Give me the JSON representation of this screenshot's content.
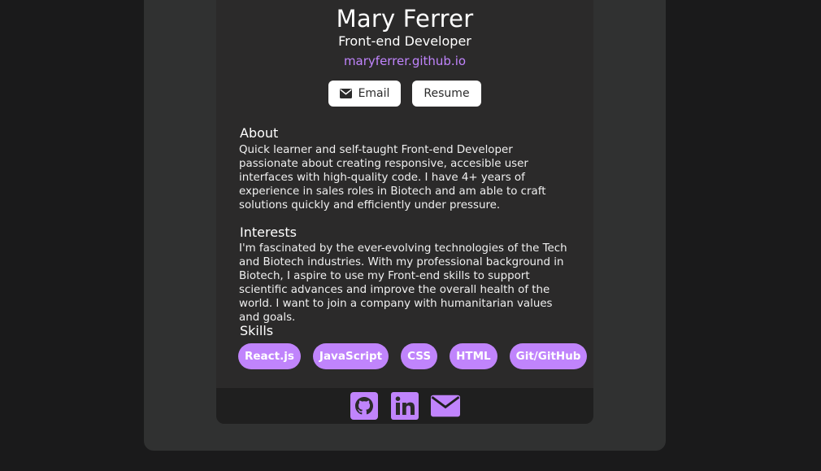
{
  "profile": {
    "name": "Mary Ferrer",
    "role": "Front-end Developer",
    "website": "maryferrer.github.io"
  },
  "buttons": {
    "email_label": "Email",
    "resume_label": "Resume"
  },
  "about": {
    "title": "About",
    "text": "Quick learner and self-taught Front-end Developer passionate about creating responsive, accesible user interfaces with high-quality code. I have 4+ years of experience in sales roles in Biotech and am able to craft solutions quickly and efficiently under pressure."
  },
  "interests": {
    "title": "Interests",
    "text": "I'm fascinated by the ever-evolving technologies of the Tech and Biotech industries. With my professional background in Biotech, I aspire to use my Front-end skills to support scientific advances and improve the overall health of the world. I want to join a company with humanitarian values and goals."
  },
  "skills": {
    "title": "Skills",
    "items": [
      "React.js",
      "JavaScript",
      "CSS",
      "HTML",
      "Git/GitHub"
    ]
  },
  "footer": {
    "icons": [
      "github-icon",
      "linkedin-icon",
      "envelope-icon"
    ]
  },
  "colors": {
    "accent": "#c084fc",
    "card": "#2b2a2a",
    "frame": "#303131",
    "background": "#1a1a1b",
    "footer": "#1f1f1f"
  }
}
